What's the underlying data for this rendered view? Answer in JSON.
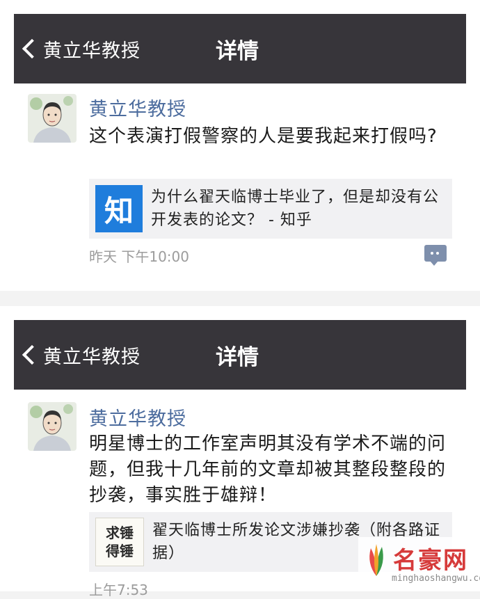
{
  "posts": [
    {
      "nav": {
        "back_label": "黄立华教授",
        "title": "详情"
      },
      "author": "黄立华教授",
      "text": "这个表演打假警察的人是要我起来打假吗?",
      "link": {
        "thumb_text": "知",
        "title": "为什么翟天临博士毕业了，但是却没有公开发表的论文？ - 知乎"
      },
      "time": "昨天 下午10:00"
    },
    {
      "nav": {
        "back_label": "黄立华教授",
        "title": "详情"
      },
      "author": "黄立华教授",
      "text": "明星博士的工作室声明其没有学术不端的问题，但我十几年前的文章却被其整段整段的抄袭，事实胜于雄辩！",
      "link": {
        "thumb_lines": [
          "求锤",
          "得锤"
        ],
        "title": "翟天临博士所发论文涉嫌抄袭（附各路证据）"
      },
      "time": "上午7:53"
    }
  ],
  "watermark": {
    "text": "名豪网",
    "url": "minghaoshangwu.com"
  },
  "colors": {
    "navbar": "#37353a",
    "author": "#4c6c9e",
    "zhihu_blue": "#1f7ddc",
    "watermark_red": "#d63a3a"
  }
}
